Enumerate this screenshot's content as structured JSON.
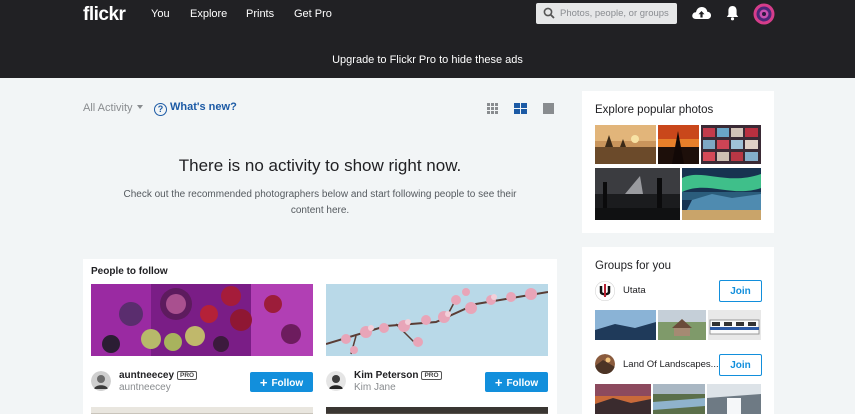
{
  "nav": {
    "logo": "flickr",
    "links": [
      "You",
      "Explore",
      "Prints",
      "Get Pro"
    ],
    "search_placeholder": "Photos, people, or groups"
  },
  "ad_banner": "Upgrade to Flickr Pro to hide these ads",
  "activity": {
    "filter_label": "All Activity",
    "whats_new": "What's new?",
    "empty_title": "There is no activity to show right now.",
    "empty_text": "Check out the recommended photographers below and start following people to see their content here."
  },
  "people": {
    "title": "People to follow",
    "follow_label": "Follow",
    "pro_badge": "PRO",
    "items": [
      {
        "name": "auntneecey",
        "username": "auntneecey"
      },
      {
        "name": "Kim Peterson",
        "username": "Kim Jane"
      }
    ]
  },
  "explore": {
    "title": "Explore popular photos"
  },
  "groups": {
    "title": "Groups for you",
    "join_label": "Join",
    "items": [
      {
        "name": "Utata"
      },
      {
        "name": "Land Of Landscapes..."
      }
    ]
  },
  "colors": {
    "nav_bg": "#212124",
    "accent": "#128fdc",
    "link": "#1c5aa5",
    "page_bg": "#f2f5f6"
  },
  "icons": [
    "search-icon",
    "upload-cloud-icon",
    "bell-icon",
    "user-avatar",
    "question-icon",
    "caret-down-icon",
    "grid-view-icon",
    "card-view-icon",
    "single-view-icon",
    "plus-icon"
  ]
}
